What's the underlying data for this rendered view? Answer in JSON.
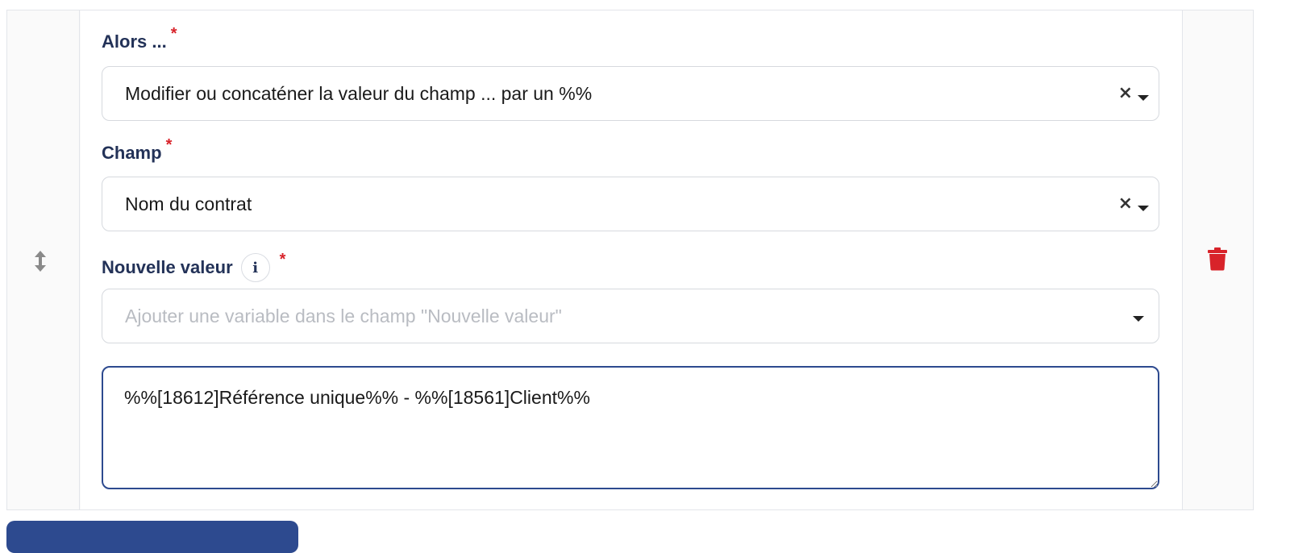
{
  "fields": {
    "then": {
      "label": "Alors ...",
      "required": "*",
      "value": "Modifier ou concaténer la valeur du champ ... par un %%",
      "clear_icon": "×"
    },
    "field": {
      "label": "Champ",
      "required": "*",
      "value": "Nom du contrat",
      "clear_icon": "×"
    },
    "new_value": {
      "label": "Nouvelle valeur",
      "info_icon": "i",
      "required": "*",
      "variable_placeholder": "Ajouter une variable dans le champ \"Nouvelle valeur\"",
      "textarea_value": "%%[18612]Référence unique%% - %%[18561]Client%%"
    }
  },
  "icons": {
    "drag": "drag-vertical-arrows-icon",
    "delete": "trash-icon"
  },
  "colors": {
    "label": "#233258",
    "required": "#d8232a",
    "delete": "#d8232a",
    "focus_border": "#2d4a8f",
    "drag_icon": "#8a8a8a"
  }
}
